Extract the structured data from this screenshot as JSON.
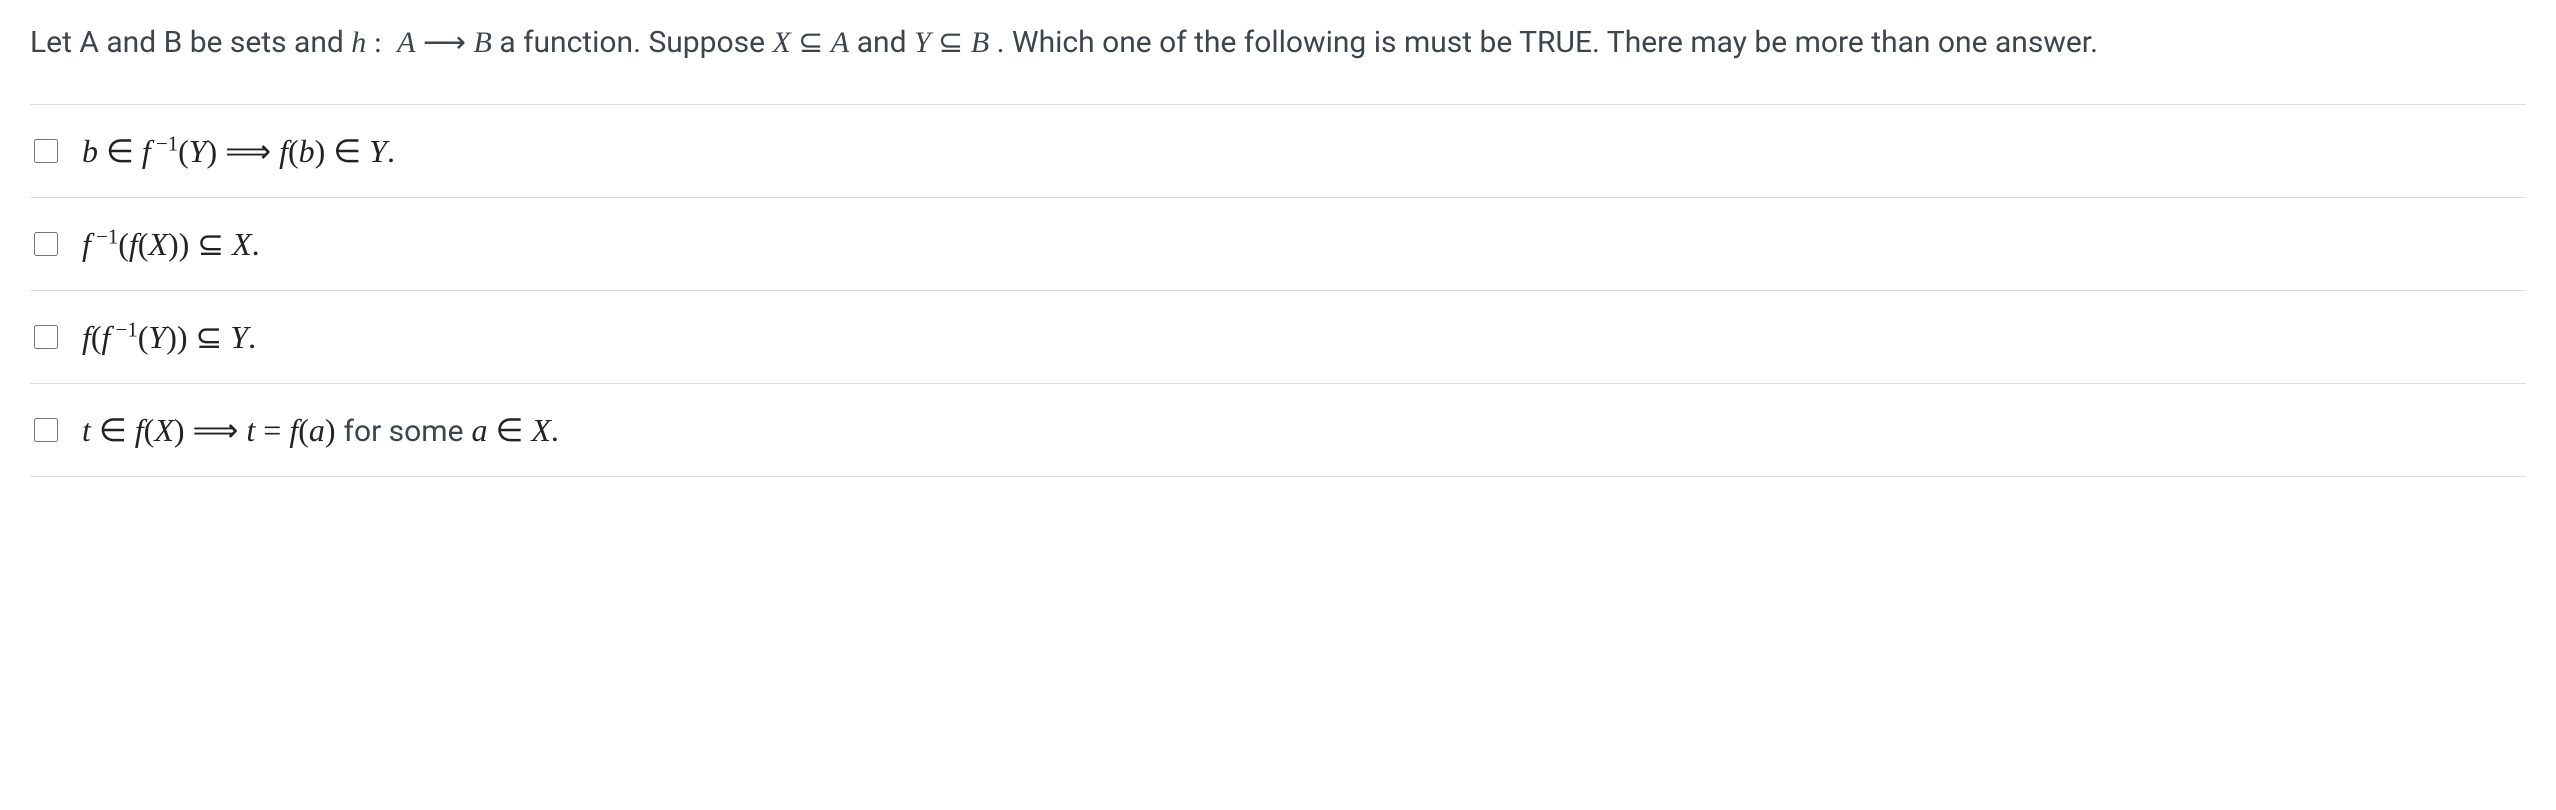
{
  "question": {
    "part1": "Let A and B be sets and ",
    "func": "h : A ⟶ B",
    "part2": " a function. Suppose ",
    "subset1": "X ⊆ A",
    "part3": " and ",
    "subset2": "Y ⊆ B",
    "part4": ". Which one of the following is must be TRUE. There may be more than one answer."
  },
  "options": [
    {
      "html": "<span class='mi'>b</span> ∈ <span class='mi'>f</span><sup>&nbsp;−1</sup>(<span class='mi'>Y</span>) ⟹ <span class='mi'>f</span>(<span class='mi'>b</span>) ∈ <span class='mi'>Y</span>."
    },
    {
      "html": "<span class='mi'>f</span><sup>&nbsp;−1</sup>(<span class='mi'>f</span>(<span class='mi'>X</span>)) ⊆ <span class='mi'>X</span>."
    },
    {
      "html": "<span class='mi'>f</span>(<span class='mi'>f</span><sup>&nbsp;−1</sup>(<span class='mi'>Y</span>)) ⊆ <span class='mi'>Y</span>."
    },
    {
      "html": "<span class='mi'>t</span> ∈ <span class='mi'>f</span>(<span class='mi'>X</span>) ⟹ <span class='mi'>t</span> = <span class='mi'>f</span>(<span class='mi'>a</span>) <span class='sans'>for some</span> <span class='mi'>a</span> ∈ <span class='mi'>X</span>."
    }
  ]
}
